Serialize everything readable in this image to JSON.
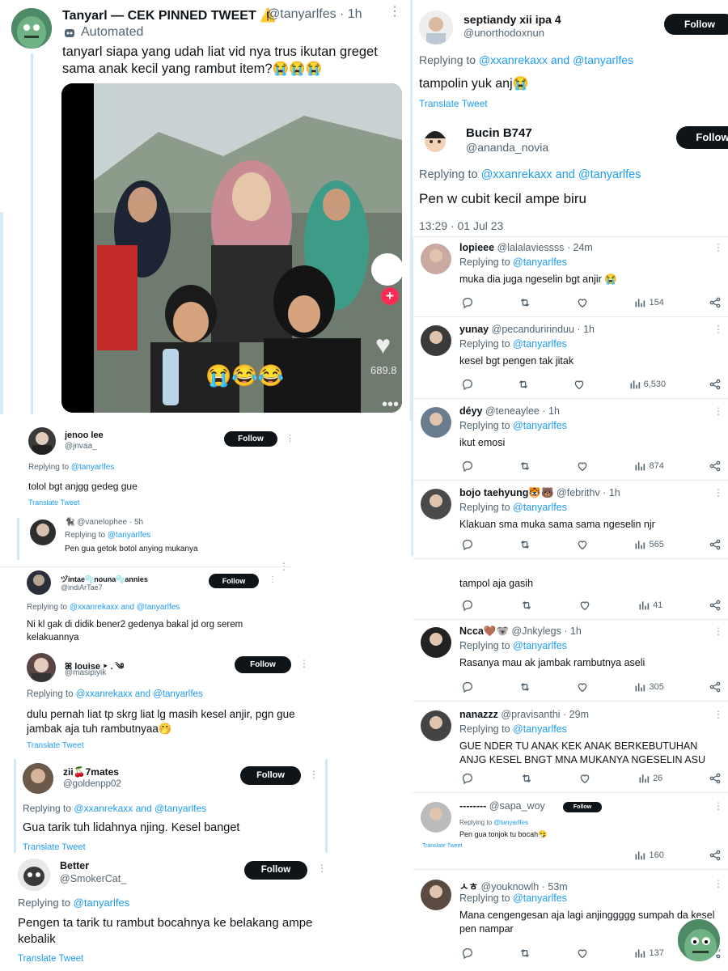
{
  "main_tweet": {
    "name": "Tanyarl — CEK PINNED TWEET ⚠️",
    "handle": "@tanyarlfes",
    "time": "· 1h",
    "automated": "Automated",
    "text": "tanyarl siapa yang udah liat vid nya trus ikutan greget sama anak kecil yang rambut item?😭😭😭",
    "video_count": "689.8",
    "video_emojis": "😭😂😂"
  },
  "left_replies": [
    {
      "name": "jenoo lee",
      "handle": "@jnvaa_",
      "follow": "Follow",
      "replying": "Replying to",
      "to": "@tanyarlfes",
      "text": "tolol bgt anjgg gedeg gue",
      "translate": "Translate Tweet"
    },
    {
      "handle": "@vanelophee · 5h",
      "replying": "Replying to",
      "to": "@tanyarlfes",
      "text": "Pen gua getok botol anying mukanya"
    },
    {
      "name": "ヅintae🫧nouna🫧annies",
      "handle": "@indiArTae7",
      "follow": "Follow",
      "replying": "Replying to",
      "to": "@xxanrekaxx and @tanyarlfes",
      "text": "Ni kl gak di didik bener2 gedenya bakal jd org serem kelakuannya"
    },
    {
      "name": "ꕤ louise ‣ . ༄",
      "handle": "@masipiyik",
      "follow": "Follow",
      "replying": "Replying to",
      "to": "@xxanrekaxx and @tanyarlfes",
      "text": "dulu pernah liat tp skrg liat lg masih kesel anjir, pgn gue jambak aja tuh rambutnyaa🤭",
      "translate": "Translate Tweet"
    },
    {
      "name": "zii🍒7mates",
      "handle": "@goldenpp02",
      "follow": "Follow",
      "replying": "Replying to",
      "to": "@xxanrekaxx and @tanyarlfes",
      "text": "Gua tarik tuh lidahnya njing. Kesel banget",
      "translate": "Translate Tweet"
    },
    {
      "name": "Better",
      "handle": "@SmokerCat_",
      "follow": "Follow",
      "replying": "Replying to",
      "to": "@tanyarlfes",
      "text": "Pengen ta tarik tu rambut bocahnya ke belakang ampe kebalik",
      "translate": "Translate Tweet"
    }
  ],
  "right_top": [
    {
      "name": "septiandy xii ipa 4",
      "handle": "@unorthodoxnun",
      "follow": "Follow",
      "replying": "Replying to",
      "to": "@xxanrekaxx and @tanyarlfes",
      "text": "tampolin yuk anj😭",
      "translate": "Translate Tweet"
    },
    {
      "name": "Bucin B747",
      "handle": "@ananda_novia",
      "follow": "Follow",
      "replying": "Replying to",
      "to": "@xxanrekaxx and @tanyarlfes",
      "text": "Pen w cubit kecil ampe biru",
      "timestamp": "13:29 · 01 Jul 23"
    }
  ],
  "right_replies": [
    {
      "name": "lopieee",
      "meta": "@lalalaviessss · 24m",
      "replying": "Replying to",
      "to": "@tanyarlfes",
      "text": "muka dia juga ngeselin bgt anjir 😭",
      "views": "154"
    },
    {
      "name": "yunay",
      "meta": "@pecanduririnduu · 1h",
      "replying": "Replying to",
      "to": "@tanyarlfes",
      "text": "kesel bgt pengen tak jitak",
      "views": "6,530"
    },
    {
      "name": "déyy",
      "meta": "@teneaylee · 1h",
      "replying": "Replying to",
      "to": "@tanyarlfes",
      "text": "ikut emosi",
      "views": "874"
    },
    {
      "name": "bojo taehyung🐯🐻",
      "meta": "@febrithv · 1h",
      "replying": "Replying to",
      "to": "@tanyarlfes",
      "text": "Klakuan sma muka sama sama ngeselin njr",
      "views": "565"
    },
    {
      "text": "tampol aja gasih",
      "views": "41"
    },
    {
      "name": "Ncca🤎🐨",
      "meta": "@Jnkylegs · 1h",
      "replying": "Replying to",
      "to": "@tanyarlfes",
      "text": "Rasanya mau ak jambak rambutnya aseli",
      "views": "305"
    },
    {
      "name": "nanazzz",
      "meta": "@pravisanthi · 29m",
      "replying": "Replying to",
      "to": "@tanyarlfes",
      "text": "GUE NDER TU ANAK KEK ANAK BERKEBUTUHAN ANJG KESEL BNGT MNA MUKANYA NGESELIN ASU",
      "views": "26"
    },
    {
      "name": "‐‐‐‐‐‐‐‐",
      "meta": "@sapa_woy",
      "follow": "Follow",
      "replying": "Replying to",
      "to": "@tanyarlfes",
      "text": "Pen gua tonjok tu bocah🤧",
      "translate": "Translate Tweet",
      "views": "160"
    },
    {
      "name": "ㅅㅎ",
      "meta": "@youknowlh · 53m",
      "replying": "Replying to",
      "to": "@tanyarlfes",
      "text": "Mana cengengesan aja lagi anjinggggg sumpah da kesel pen nampar",
      "views": "137"
    }
  ]
}
